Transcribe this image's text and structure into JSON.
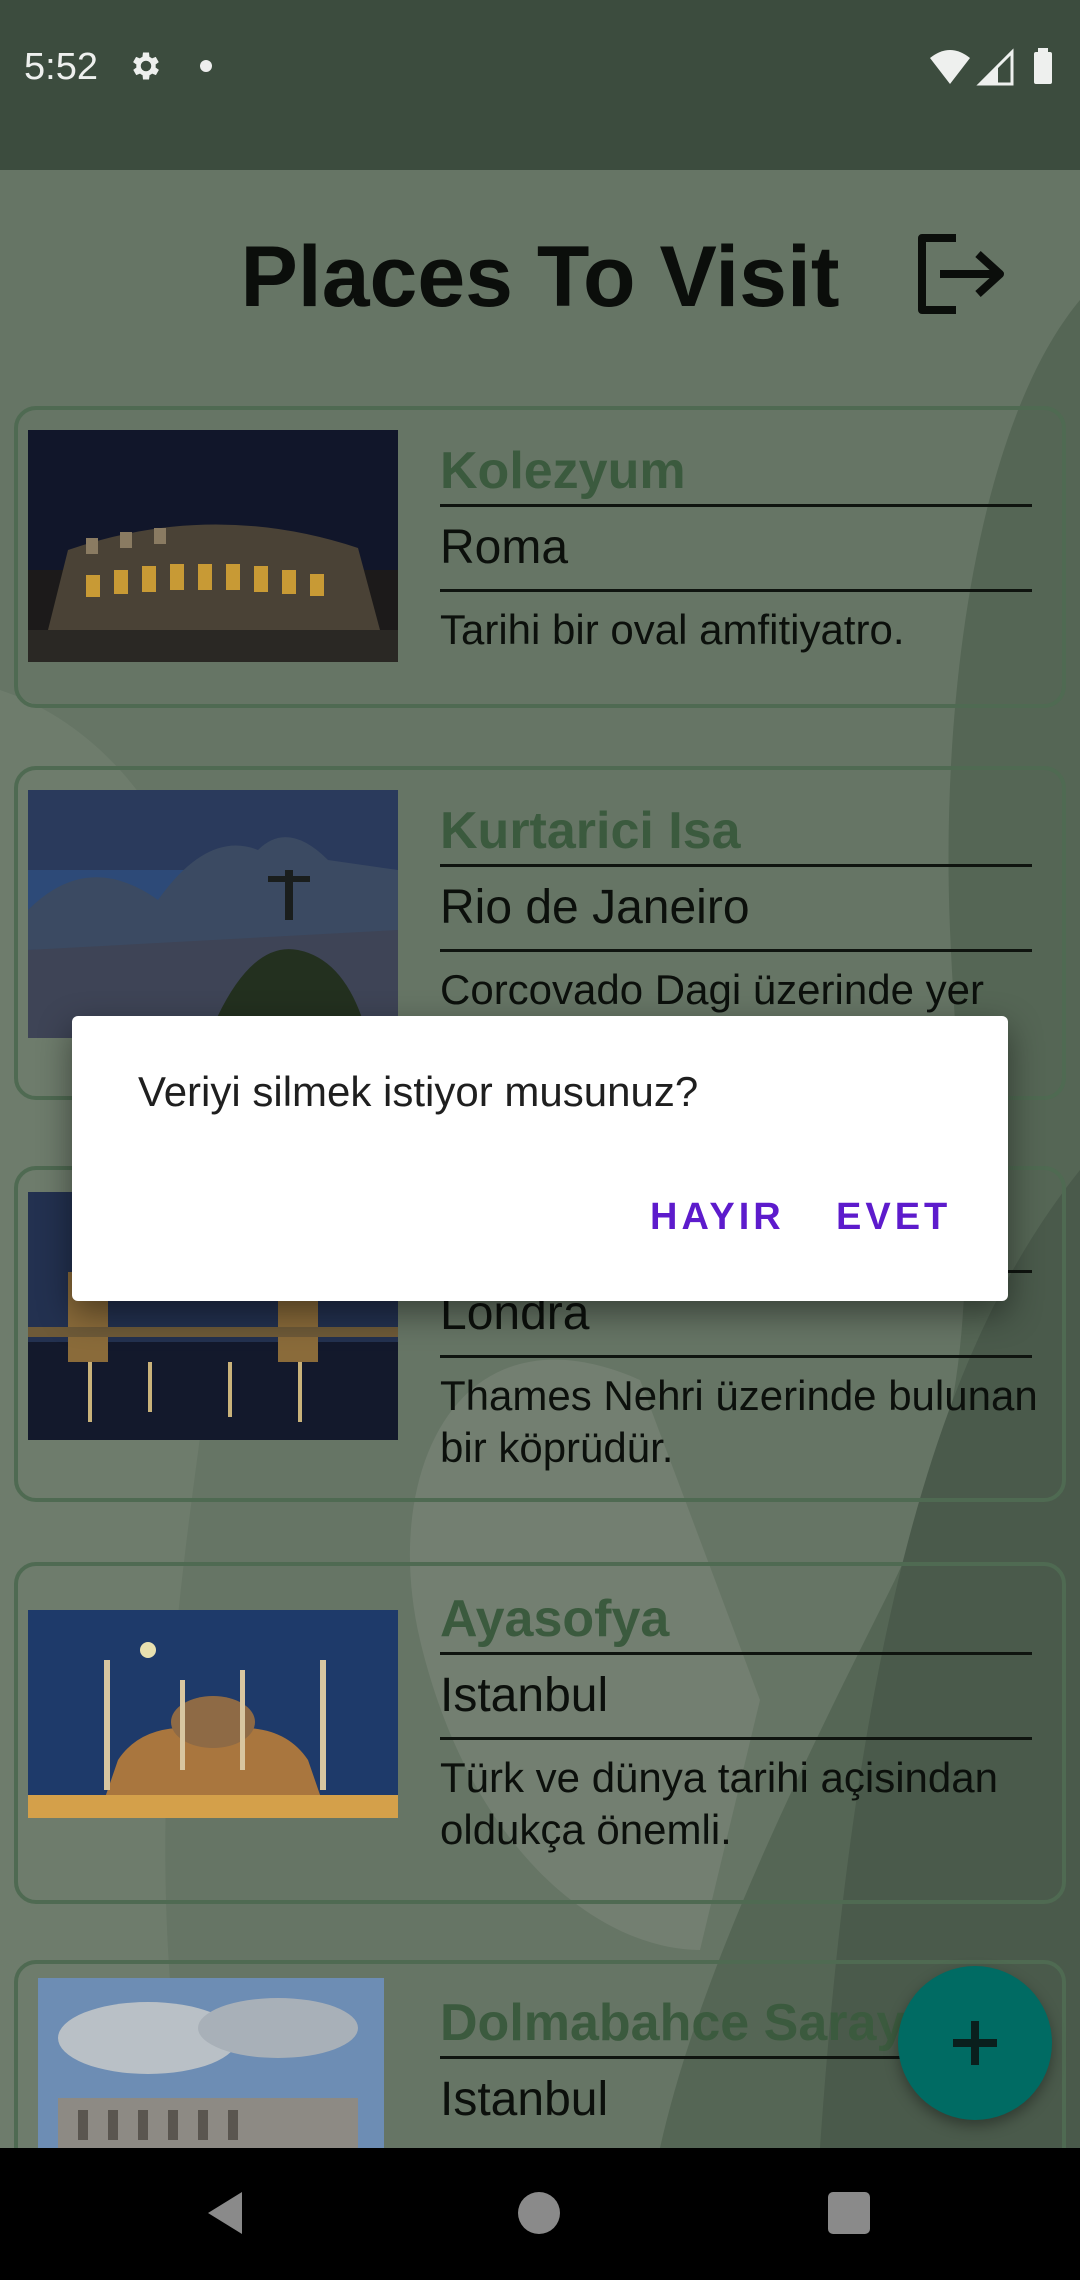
{
  "status_bar": {
    "time": "5:52",
    "icons": [
      "gear-icon",
      "notification-dot-icon",
      "wifi-icon",
      "signal-icon",
      "battery-icon"
    ]
  },
  "header": {
    "title": "Places To Visit",
    "logout_icon": "logout-icon"
  },
  "places": [
    {
      "name": "Kolezyum",
      "city": "Roma",
      "description": "Tarihi bir oval amfitiyatro."
    },
    {
      "name": "Kurtarici Isa",
      "city": "Rio de Janeiro",
      "description": "Corcovado Dagi üzerinde yer"
    },
    {
      "name": "",
      "city": "Londra",
      "description": "Thames Nehri üzerinde bulunan bir köprüdür."
    },
    {
      "name": "Ayasofya",
      "city": "Istanbul",
      "description": "Türk ve dünya tarihi açisindan oldukça önemli."
    },
    {
      "name": "Dolmabahce Sarayi",
      "city": "Istanbul",
      "description": ""
    }
  ],
  "fab": {
    "icon": "plus-icon"
  },
  "dialog": {
    "message": "Veriyi silmek istiyor musunuz?",
    "no_label": "HAYIR",
    "yes_label": "EVET"
  },
  "nav_bar": {
    "icons": [
      "back-icon",
      "home-icon",
      "recents-icon"
    ]
  },
  "colors": {
    "status_bar": "#3c4c3e",
    "scrim_background": "#667565",
    "card_title": "#3b5a3e",
    "dialog_button": "#5d1bcc",
    "fab": "#006b63"
  }
}
